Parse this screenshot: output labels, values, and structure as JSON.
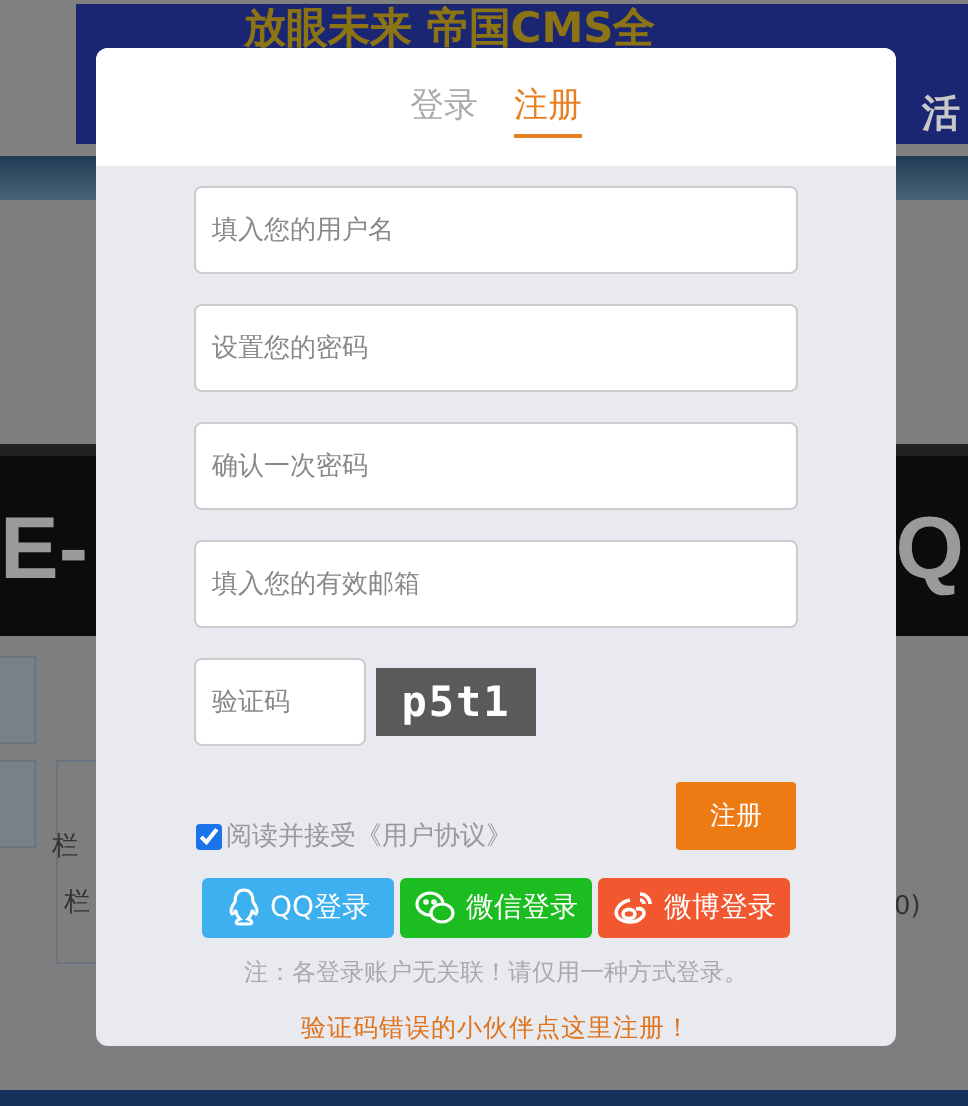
{
  "background": {
    "banner_title": "放眼未来 帝国CMS全",
    "banner_subtitle": "活",
    "band_left": "E-",
    "band_right": "Q",
    "panel_lines": [
      "栏",
      "栏"
    ],
    "panel_right": "0)"
  },
  "modal": {
    "tabs": [
      {
        "label": "登录",
        "selected": false
      },
      {
        "label": "注册",
        "selected": true
      }
    ],
    "fields": [
      {
        "placeholder": "填入您的用户名"
      },
      {
        "placeholder": "设置您的密码"
      },
      {
        "placeholder": "确认一次密码"
      },
      {
        "placeholder": "填入您的有效邮箱"
      }
    ],
    "captcha": {
      "placeholder": "验证码",
      "image_text": "p5t1"
    },
    "agreement": {
      "checked": true,
      "label": "阅读并接受《用户协议》"
    },
    "submit": "注册",
    "social": [
      {
        "kind": "qq",
        "label": "QQ登录",
        "color": "#3fb0ef"
      },
      {
        "kind": "wechat",
        "label": "微信登录",
        "color": "#1bbd20"
      },
      {
        "kind": "weibo",
        "label": "微博登录",
        "color": "#f2582f"
      }
    ],
    "note": "注：各登录账户无关联！请仅用一种方式登录。",
    "help_link": "验证码错误的小伙伴点这里注册！"
  }
}
